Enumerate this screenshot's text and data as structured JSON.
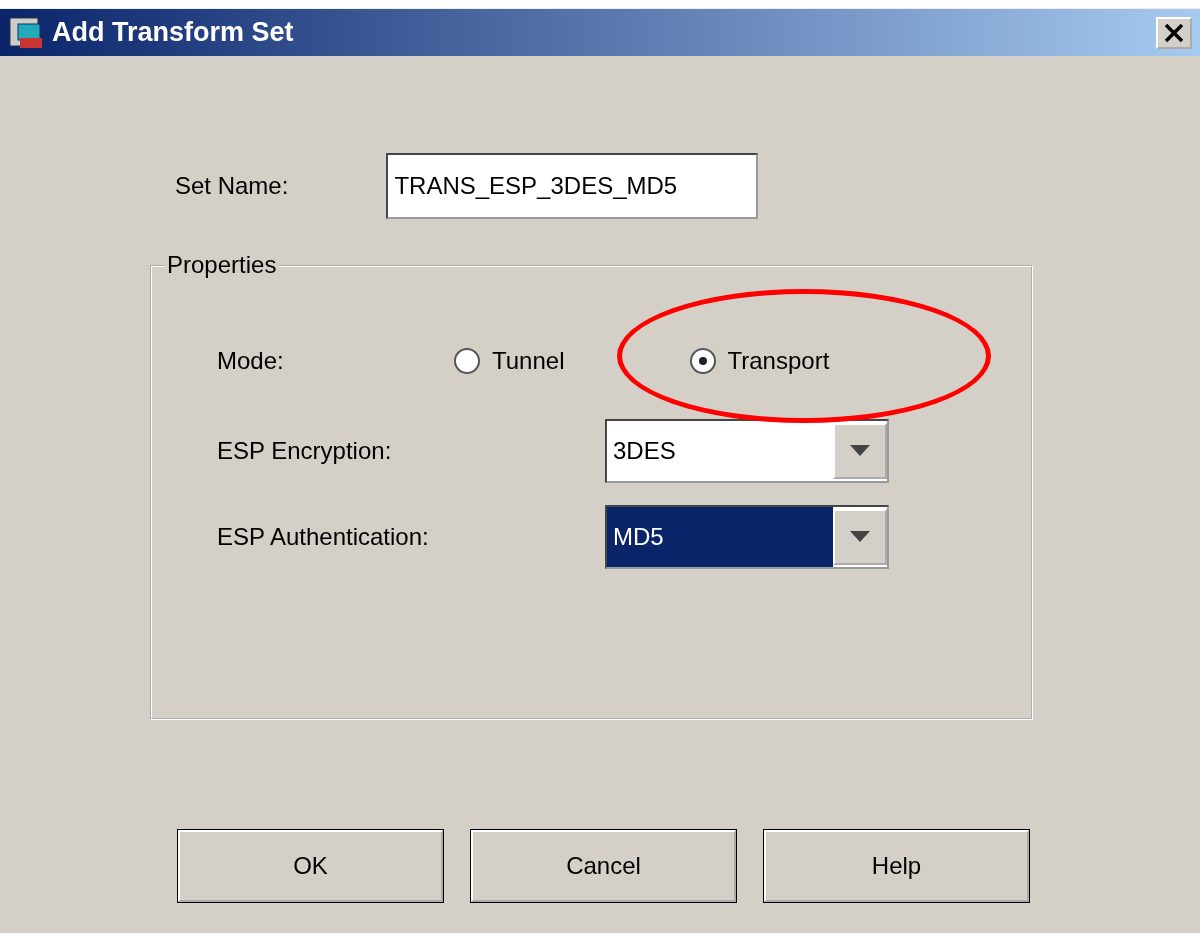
{
  "window": {
    "title": "Add Transform Set"
  },
  "set_name": {
    "label": "Set Name:",
    "value": "TRANS_ESP_3DES_MD5"
  },
  "properties": {
    "title": "Properties",
    "mode": {
      "label": "Mode:",
      "options": [
        {
          "label": "Tunnel",
          "selected": false
        },
        {
          "label": "Transport",
          "selected": true
        }
      ]
    },
    "selects": [
      {
        "label": "ESP Encryption:",
        "value": "3DES",
        "focused": false
      },
      {
        "label": "ESP Authentication:",
        "value": "MD5",
        "focused": true
      }
    ]
  },
  "buttons": [
    "OK",
    "Cancel",
    "Help"
  ]
}
